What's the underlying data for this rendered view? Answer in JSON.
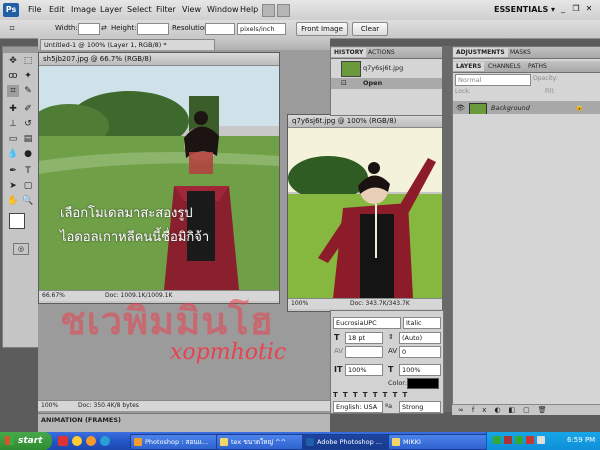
{
  "menubar": {
    "items": [
      "File",
      "Edit",
      "Image",
      "Layer",
      "Select",
      "Filter",
      "View",
      "Window",
      "Help"
    ],
    "workspace": "ESSENTIALS ▾"
  },
  "options": {
    "width_label": "Width:",
    "height_label": "Height:",
    "resolution_label": "Resolution:",
    "resolution_unit": "pixels/inch",
    "front_image": "Front Image",
    "clear": "Clear"
  },
  "main_doc": {
    "tab_title": "Untitled-1 @ 100% (Layer 1, RGB/8) *",
    "zoom": "100%",
    "status": "Doc: 350.4K/8 bytes"
  },
  "win1": {
    "title": "sh5jb207.jpg @ 66.7% (RGB/8)",
    "zoom": "66.67%",
    "status": "Doc: 1009.1K/1009.1K"
  },
  "win2": {
    "title": "q7y6sj6t.jpg @ 100% (RGB/8)",
    "zoom": "100%",
    "status": "Doc: 343.7K/343.7K"
  },
  "overlay": {
    "line1": "เลือกโมเดลมาสะสองรูป",
    "line2": "ไอดอลเกาหลีคนนี้ชื่อมิกิจ้า",
    "watermark_thai": "ชเวพิมมินโฮ",
    "watermark_latin": "xopmhotic"
  },
  "history": {
    "tabs": [
      "HISTORY",
      "ACTIONS"
    ],
    "snapshot": "q7y6sj6t.jpg",
    "step": "Open"
  },
  "adjust": {
    "tabs": [
      "ADJUSTMENTS",
      "MASKS"
    ]
  },
  "layers": {
    "tabs": [
      "LAYERS",
      "CHANNELS",
      "PATHS"
    ],
    "blend": "Normal",
    "opacity_label": "Opacity:",
    "fill_label": "Fill:",
    "lock_label": "Lock:",
    "layer_name": "Background"
  },
  "character": {
    "font": "EucrosiaUPC",
    "style": "Italic",
    "size": "18 pt",
    "leading": "(Auto)",
    "kerning": "0",
    "vscale": "100%",
    "hscale": "100%",
    "color_label": "Color:",
    "language": "English: USA",
    "aa": "Strong"
  },
  "bottom_panel": "ANIMATION (FRAMES)",
  "taskbar": {
    "start": "start",
    "tasks": [
      "Photoshop : สอนแ...",
      "tex ขนาดใหญ่ ^^",
      "Adobe Photoshop ...",
      "MIKKI"
    ],
    "clock": "6:59 PM"
  },
  "colors": {
    "accent": "#1f5fa6",
    "taskbar": "#2456c7",
    "watermark": "#e8414f"
  }
}
